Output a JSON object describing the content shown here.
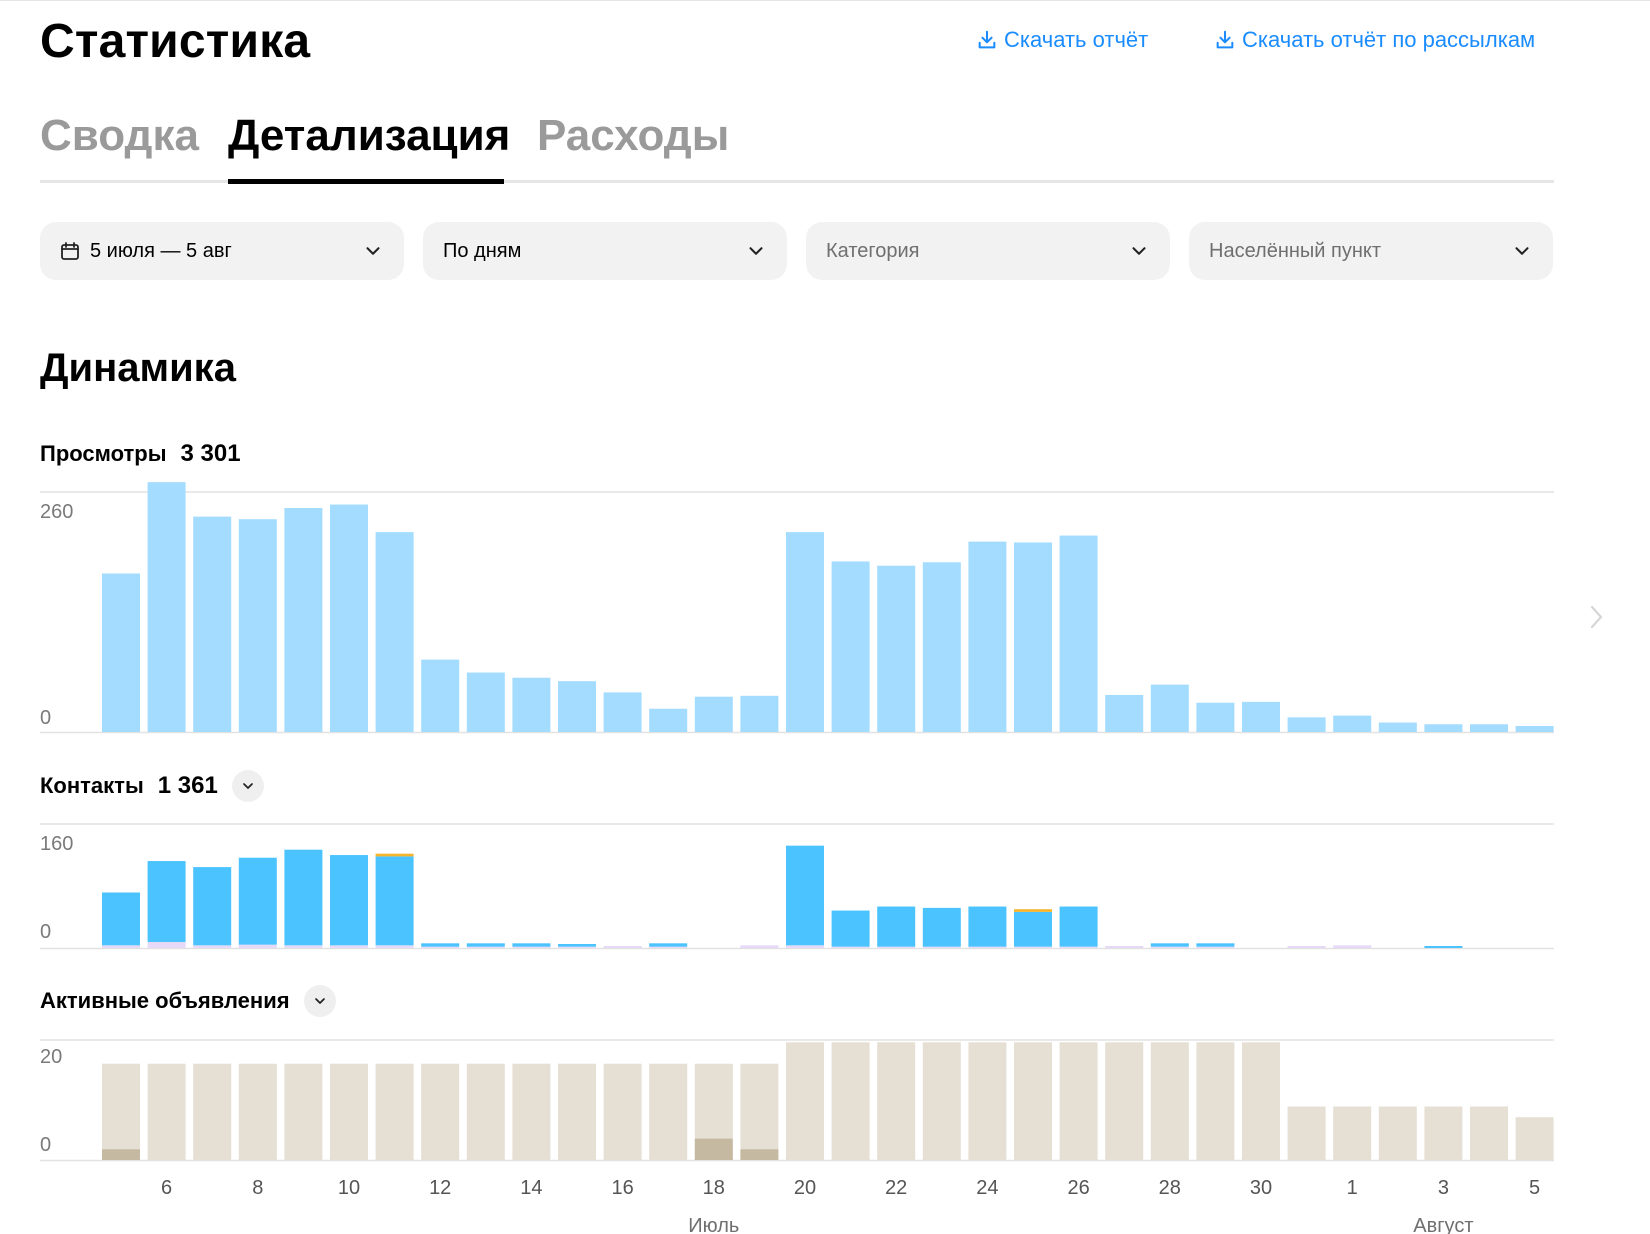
{
  "header": {
    "title": "Статистика",
    "download_report": "Скачать отчёт",
    "download_mailing_report": "Скачать отчёт по рассылкам"
  },
  "tabs": [
    {
      "label": "Сводка",
      "active": false
    },
    {
      "label": "Детализация",
      "active": true
    },
    {
      "label": "Расходы",
      "active": false
    }
  ],
  "filters": {
    "period": "5 июля — 5 авг",
    "granularity": "По дням",
    "category_placeholder": "Категория",
    "city_placeholder": "Населённый пункт"
  },
  "section_title": "Динамика",
  "colors": {
    "accent_link": "#1a8cff",
    "views_bar": "#a3dcff",
    "contacts_bar": "#4bc3ff",
    "contacts_secondary": "#e6d9f7",
    "contacts_tertiary": "#f7b32b",
    "ads_bar": "#e5dfd4",
    "ads_secondary": "#c6b9a2",
    "weekend_tick": "#f26b6b"
  },
  "metrics": {
    "views": {
      "label": "Просмотры",
      "total": "3 301"
    },
    "contacts": {
      "label": "Контакты",
      "total": "1 361"
    },
    "active_ads": {
      "label": "Активные объявления"
    }
  },
  "chart_data": [
    {
      "type": "bar",
      "title": "Просмотры",
      "categories": [
        "5",
        "6",
        "7",
        "8",
        "9",
        "10",
        "11",
        "12",
        "13",
        "14",
        "15",
        "16",
        "17",
        "18",
        "19",
        "20",
        "21",
        "22",
        "23",
        "24",
        "25",
        "26",
        "27",
        "28",
        "29",
        "30",
        "31",
        "1",
        "2",
        "3",
        "4",
        "5"
      ],
      "series": [
        {
          "values": [
            184,
            290,
            250,
            247,
            260,
            264,
            232,
            84,
            69,
            63,
            59,
            46,
            27,
            41,
            42,
            232,
            198,
            193,
            197,
            221,
            220,
            228,
            43,
            55,
            34,
            35,
            17,
            19,
            11,
            9,
            9,
            7
          ]
        }
      ],
      "ylim": [
        0,
        260
      ],
      "yticks": [
        "0",
        "260"
      ]
    },
    {
      "type": "bar",
      "title": "Контакты",
      "categories": [
        "5",
        "6",
        "7",
        "8",
        "9",
        "10",
        "11",
        "12",
        "13",
        "14",
        "15",
        "16",
        "17",
        "18",
        "19",
        "20",
        "21",
        "22",
        "23",
        "24",
        "25",
        "26",
        "27",
        "28",
        "29",
        "30",
        "31",
        "1",
        "2",
        "3",
        "4",
        "5"
      ],
      "series": [
        {
          "values": [
            79,
            121,
            117,
            130,
            143,
            135,
            133,
            5,
            5,
            5,
            4,
            0,
            5,
            0,
            0,
            149,
            54,
            60,
            58,
            60,
            52,
            60,
            0,
            5,
            5,
            0,
            0,
            0,
            0,
            3,
            0,
            0
          ]
        },
        {
          "values": [
            4,
            9,
            4,
            5,
            4,
            4,
            4,
            2,
            2,
            2,
            2,
            3,
            2,
            0,
            4,
            4,
            2,
            2,
            2,
            2,
            2,
            2,
            3,
            2,
            2,
            0,
            3,
            4,
            0,
            0,
            0,
            0
          ]
        },
        {
          "values": [
            0,
            0,
            0,
            0,
            0,
            0,
            4,
            0,
            0,
            0,
            0,
            0,
            0,
            0,
            0,
            0,
            0,
            0,
            0,
            0,
            4,
            0,
            0,
            0,
            0,
            0,
            0,
            0,
            0,
            0,
            0,
            0
          ]
        }
      ],
      "stacked": true,
      "ylim": [
        0,
        160
      ],
      "yticks": [
        "0",
        "160"
      ]
    },
    {
      "type": "bar",
      "title": "Активные объявления",
      "categories": [
        "5",
        "6",
        "7",
        "8",
        "9",
        "10",
        "11",
        "12",
        "13",
        "14",
        "15",
        "16",
        "17",
        "18",
        "19",
        "20",
        "21",
        "22",
        "23",
        "24",
        "25",
        "26",
        "27",
        "28",
        "29",
        "30",
        "31",
        "1",
        "2",
        "3",
        "4",
        "5"
      ],
      "series": [
        {
          "values": [
            18,
            18,
            18,
            18,
            18,
            18,
            18,
            18,
            18,
            18,
            18,
            18,
            18,
            18,
            18,
            22,
            22,
            22,
            22,
            22,
            22,
            22,
            22,
            22,
            22,
            22,
            10,
            10,
            10,
            10,
            10,
            8
          ]
        },
        {
          "values": [
            2,
            0,
            0,
            0,
            0,
            0,
            0,
            0,
            0,
            0,
            0,
            0,
            0,
            4,
            2,
            0,
            0,
            0,
            0,
            0,
            0,
            0,
            0,
            0,
            0,
            0,
            0,
            0,
            0,
            0,
            0,
            0
          ]
        }
      ],
      "ylim": [
        0,
        20
      ],
      "yticks": [
        "0",
        "20"
      ]
    }
  ],
  "x_axis": {
    "tick_labels": [
      {
        "label": "6",
        "index": 1,
        "weekend": false
      },
      {
        "label": "8",
        "index": 3,
        "weekend": true
      },
      {
        "label": "10",
        "index": 5,
        "weekend": false
      },
      {
        "label": "12",
        "index": 7,
        "weekend": false
      },
      {
        "label": "14",
        "index": 9,
        "weekend": false
      },
      {
        "label": "16",
        "index": 11,
        "weekend": true
      },
      {
        "label": "18",
        "index": 13,
        "weekend": false
      },
      {
        "label": "20",
        "index": 15,
        "weekend": false
      },
      {
        "label": "22",
        "index": 17,
        "weekend": true
      },
      {
        "label": "24",
        "index": 19,
        "weekend": false
      },
      {
        "label": "26",
        "index": 21,
        "weekend": false
      },
      {
        "label": "28",
        "index": 23,
        "weekend": false
      },
      {
        "label": "30",
        "index": 25,
        "weekend": true
      },
      {
        "label": "1",
        "index": 27,
        "weekend": false
      },
      {
        "label": "3",
        "index": 29,
        "weekend": false
      },
      {
        "label": "5",
        "index": 31,
        "weekend": true
      }
    ],
    "months": [
      {
        "label": "Июль",
        "index": 13
      },
      {
        "label": "Август",
        "index": 29
      }
    ]
  }
}
